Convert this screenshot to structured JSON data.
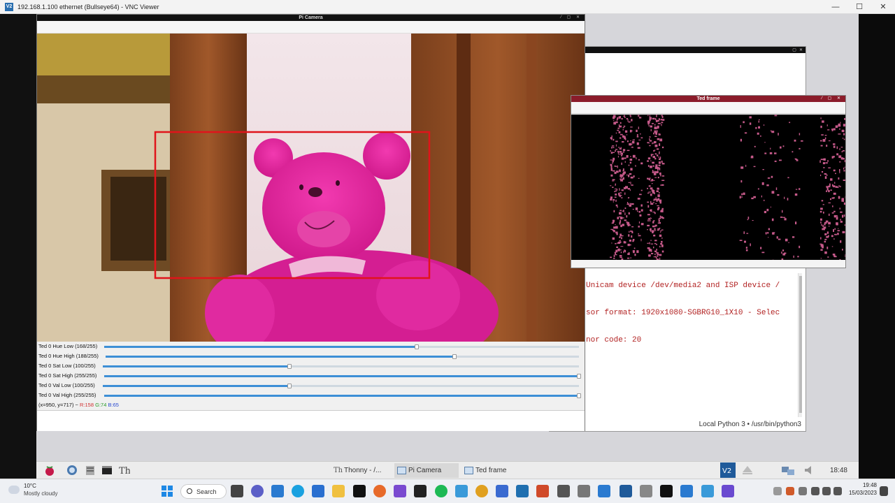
{
  "vnc": {
    "title": "192.168.1.100 ethernet (Bullseye64) - VNC Viewer",
    "minimize": "—",
    "maximize": "☐",
    "close": "✕"
  },
  "picam": {
    "title": "Pi Camera",
    "sliders": [
      {
        "label": "Ted 0 Hue Low (168/255)",
        "value": 168,
        "max": 255
      },
      {
        "label": "Ted 0 Hue High (188/255)",
        "value": 188,
        "max": 255
      },
      {
        "label": "Ted 0 Sat Low (100/255)",
        "value": 100,
        "max": 255
      },
      {
        "label": "Ted 0 Sat High (255/255)",
        "value": 255,
        "max": 255
      },
      {
        "label": "Ted 0 Val Low (100/255)",
        "value": 100,
        "max": 255
      },
      {
        "label": "Ted 0 Val High (255/255)",
        "value": 255,
        "max": 255
      }
    ],
    "status": {
      "coords": "(x=950, y=717) ~",
      "r": "R:158",
      "g": "G:74",
      "b": "B:65"
    }
  },
  "ted_frame": {
    "title": "Ted frame"
  },
  "thonny": {
    "shell_lines": [
      "Unicam device /dev/media2 and ISP device /",
      "sor format: 1920x1080-SGBRG10_1X10 - Selec",
      "nor code: 20"
    ],
    "status": "Local Python 3 • /usr/bin/python3"
  },
  "pi_taskbar": {
    "tasks": [
      {
        "label": "Thonny - /...",
        "active": false
      },
      {
        "label": "Pi Camera",
        "active": true
      },
      {
        "label": "Ted frame",
        "active": false
      }
    ],
    "clock": "18:48"
  },
  "win_taskbar": {
    "weather_temp": "10°C",
    "weather_desc": "Mostly cloudy",
    "search_label": "Search",
    "time": "19:48",
    "date": "15/03/2023"
  },
  "colors": {
    "box": "#e0141b",
    "slider": "#3d8fd6",
    "ted_bar": "#8b1c2a",
    "shell_text": "#b22222"
  }
}
